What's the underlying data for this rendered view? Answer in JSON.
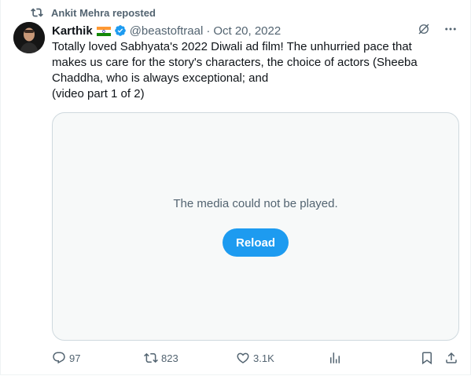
{
  "repost": {
    "label": "Ankit Mehra reposted"
  },
  "post": {
    "author_name": "Karthik",
    "handle": "@beastoftraal",
    "separator": "·",
    "date": "Oct 20, 2022",
    "text_lines": [
      "Totally loved Sabhyata's 2022 Diwali ad film! The unhurried pace that",
      "makes us care for the story's characters, the choice of actors (Sheeba",
      "Chaddha, who is always exceptional; and",
      "(video part 1 of 2)"
    ]
  },
  "media": {
    "message": "The media could not be played.",
    "reload_label": "Reload"
  },
  "actions": {
    "replies": "97",
    "reposts": "823",
    "likes": "3.1K"
  },
  "colors": {
    "accent": "#1d9bf0",
    "secondary_text": "#536471",
    "border": "#cfd9de"
  },
  "icons": [
    "repost-icon",
    "verified-badge-icon",
    "india-flag-icon",
    "grok-icon",
    "more-icon",
    "reply-icon",
    "like-icon",
    "views-icon",
    "bookmark-icon",
    "share-icon"
  ]
}
